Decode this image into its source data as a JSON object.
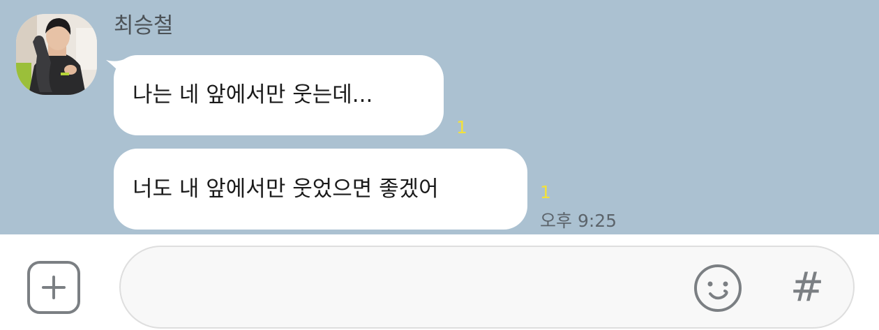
{
  "chat": {
    "sender_name": "최승철",
    "messages": [
      {
        "text": "나는 네 앞에서만 웃는데...",
        "unread_count": "1"
      },
      {
        "text": "너도 내 앞에서만 웃었으면 좋겠어",
        "unread_count": "1",
        "timestamp": "오후 9:25"
      }
    ]
  },
  "input_bar": {
    "message_placeholder": "",
    "icons": [
      "plus-icon",
      "emoji-icon",
      "hash-icon"
    ],
    "hash_glyph": "#"
  },
  "colors": {
    "chat_background": "#abc1d1",
    "bubble": "#ffffff",
    "unread_count": "#f3e13a",
    "icon": "#7b7f83"
  }
}
